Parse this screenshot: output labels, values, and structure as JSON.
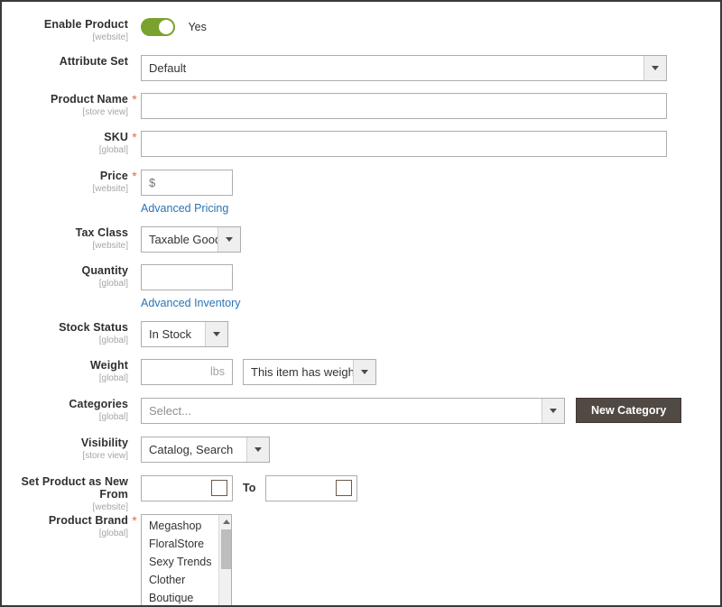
{
  "form": {
    "rows": [
      {
        "label": "Enable Product",
        "scope": "[website]",
        "required": false,
        "type": "toggle",
        "toggle_value": "Yes",
        "toggle_on": true,
        "toggle_color": "#79a22e"
      },
      {
        "label": "Attribute Set",
        "scope": "",
        "required": false,
        "type": "select",
        "value": "Default"
      },
      {
        "label": "Product Name",
        "scope": "[store view]",
        "required": true,
        "type": "text",
        "value": ""
      },
      {
        "label": "SKU",
        "scope": "[global]",
        "required": true,
        "type": "text",
        "value": ""
      },
      {
        "label": "Price",
        "scope": "[website]",
        "required": true,
        "type": "text-link",
        "placeholder": "$",
        "link": "Advanced Pricing"
      },
      {
        "label": "Tax Class",
        "scope": "[website]",
        "required": false,
        "type": "select",
        "value": "Taxable Goods"
      },
      {
        "label": "Quantity",
        "scope": "[global]",
        "required": false,
        "type": "text-link",
        "placeholder": "",
        "link": "Advanced Inventory"
      },
      {
        "label": "Stock Status",
        "scope": "[global]",
        "required": false,
        "type": "select",
        "value": "In Stock"
      },
      {
        "label": "Weight",
        "scope": "[global]",
        "required": false,
        "type": "weight",
        "value": "",
        "unit": "lbs",
        "select_value": "This item has weight"
      },
      {
        "label": "Categories",
        "scope": "[global]",
        "required": false,
        "type": "categories",
        "value": "Select...",
        "button": "New Category"
      },
      {
        "label": "Visibility",
        "scope": "[store view]",
        "required": false,
        "type": "select",
        "value": "Catalog, Search"
      },
      {
        "label": "Set Product as New From",
        "scope": "[website]",
        "required": false,
        "type": "daterange",
        "from_value": "",
        "to_label": "To",
        "to_value": ""
      },
      {
        "label": "Product Brand",
        "scope": "[global]",
        "required": true,
        "type": "multiselect",
        "options": [
          "Megashop",
          "FloralStore",
          "Sexy Trends",
          "Clother",
          "Boutique"
        ]
      }
    ]
  },
  "icons": {
    "calendar": "calendar-icon",
    "caret_down": "chevron-down-icon",
    "scroll_up": "scroll-up-arrow-icon"
  },
  "colors": {
    "toggle_on": "#79a22e",
    "link": "#2a74b5",
    "required_star": "#e06e3a",
    "button": "#514943"
  }
}
